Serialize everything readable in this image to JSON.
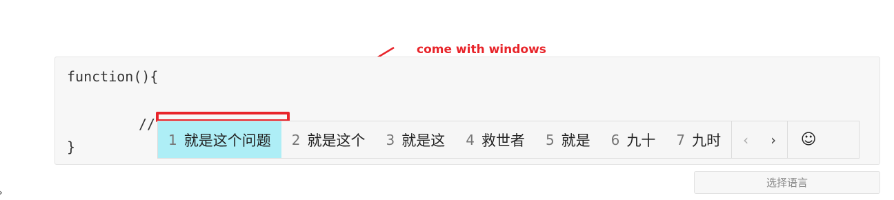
{
  "annotation": {
    "text": "come with windows"
  },
  "code": {
    "line1": "function(){",
    "line2": "//",
    "line3": "}"
  },
  "ime": {
    "candidates": [
      {
        "num": "1",
        "text": "就是这个问题"
      },
      {
        "num": "2",
        "text": "就是这个"
      },
      {
        "num": "3",
        "text": "就是这"
      },
      {
        "num": "4",
        "text": "救世者"
      },
      {
        "num": "5",
        "text": "就是"
      },
      {
        "num": "6",
        "text": "九十"
      },
      {
        "num": "7",
        "text": "九时"
      }
    ],
    "prev_glyph": "‹",
    "next_glyph": "›",
    "emoji_glyph": "☺"
  },
  "language_button": {
    "label": "选择语言"
  },
  "edge_chevron": "›",
  "colors": {
    "annotation": "#e8242a",
    "selected_candidate": "#aeeef6"
  }
}
